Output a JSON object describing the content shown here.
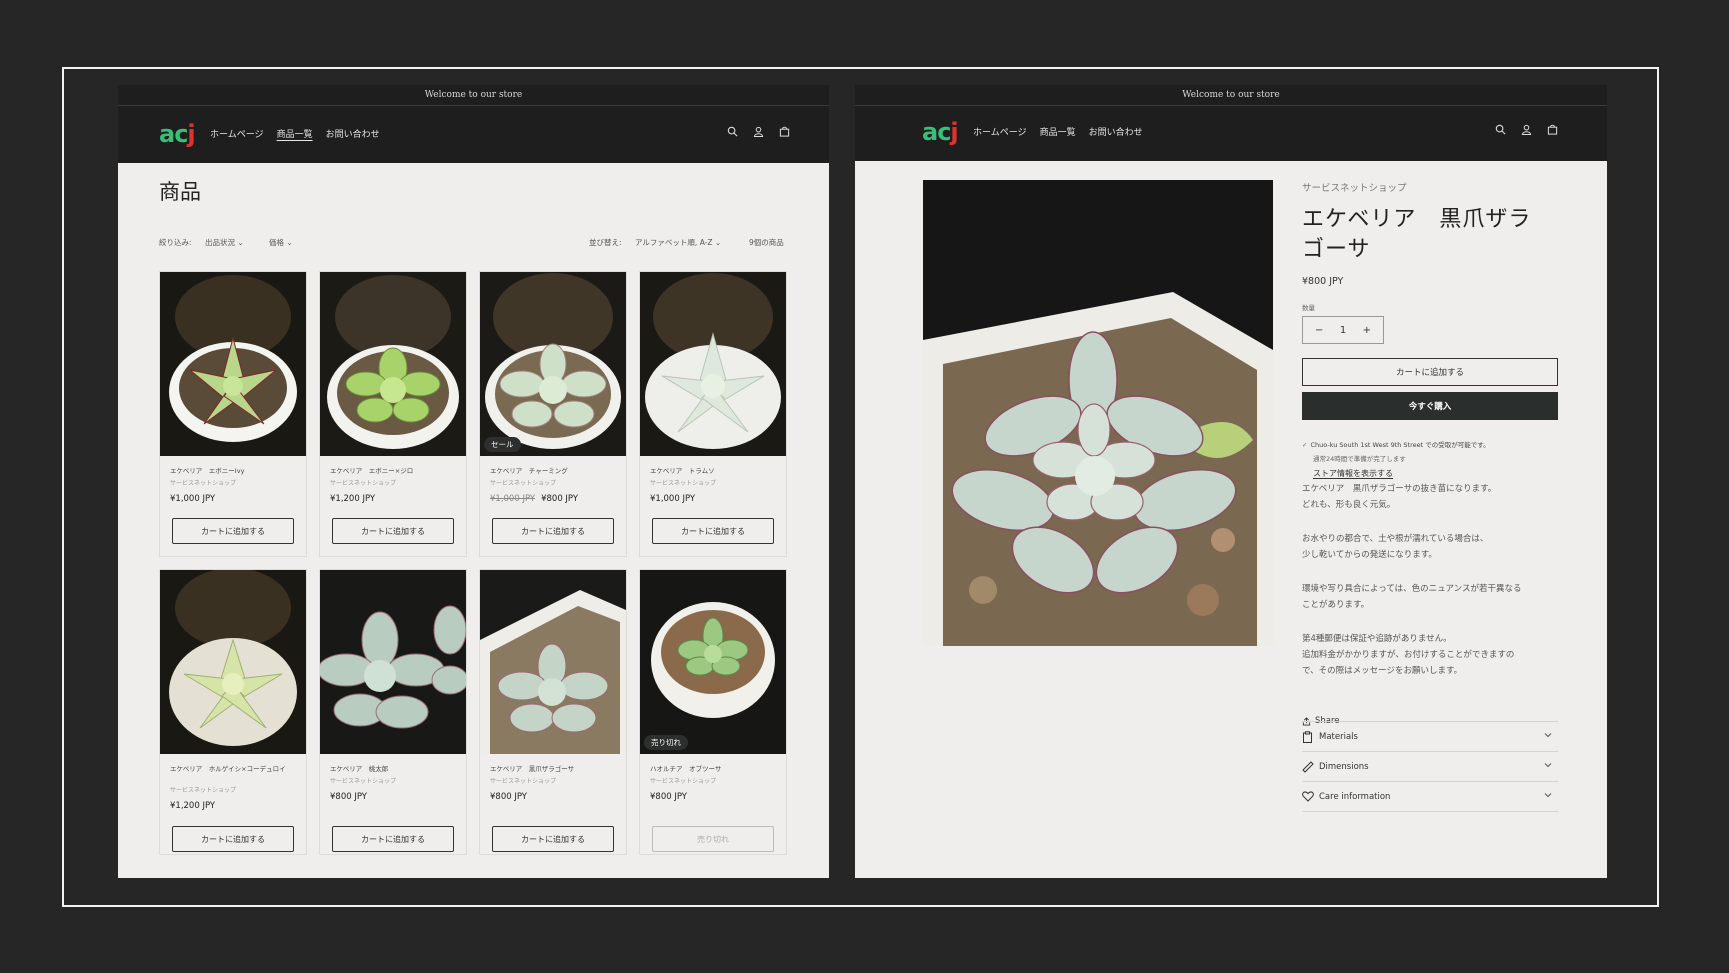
{
  "store": {
    "announcement": "Welcome to our store",
    "logo": "acj",
    "nav": [
      "ホームページ",
      "商品一覧",
      "お問い合わせ"
    ]
  },
  "collection": {
    "title": "商品",
    "filter_label": "絞り込み:",
    "filter_availability": "出品状況",
    "filter_price": "価格",
    "sort_label": "並び替え:",
    "sort_value": "アルファベット順, A-Z",
    "count": "9個の商品",
    "products": [
      {
        "name": "エケベリア　エボニーIvy",
        "vendor": "サービスネットショップ",
        "price": "¥1,000 JPY",
        "button": "カートに追加する"
      },
      {
        "name": "エケベリア　エボニー×ジロ",
        "vendor": "サービスネットショップ",
        "price": "¥1,200 JPY",
        "button": "カートに追加する"
      },
      {
        "name": "エケベリア　チャーミング",
        "vendor": "サービスネットショップ",
        "price_old": "¥1,000 JPY",
        "price": "¥800 JPY",
        "badge": "セール",
        "button": "カートに追加する"
      },
      {
        "name": "エケベリア　トラムソ",
        "vendor": "サービスネットショップ",
        "price": "¥1,000 JPY",
        "button": "カートに追加する"
      },
      {
        "name": "エケベリア　ホルゲイシ×コーデュロイ",
        "vendor": "サービスネットショップ",
        "price": "¥1,200 JPY",
        "button": "カートに追加する"
      },
      {
        "name": "エケベリア　桃太郎",
        "vendor": "サービスネットショップ",
        "price": "¥800 JPY",
        "button": "カートに追加する"
      },
      {
        "name": "エケベリア　黒爪ザラゴーサ",
        "vendor": "サービスネットショップ",
        "price": "¥800 JPY",
        "button": "カートに追加する"
      },
      {
        "name": "ハオルチア　オブツーサ",
        "vendor": "サービスネットショップ",
        "price": "¥800 JPY",
        "badge": "売り切れ",
        "button": "売り切れ"
      }
    ]
  },
  "product": {
    "vendor": "サービスネットショップ",
    "title": "エケベリア　黒爪ザラゴーサ",
    "price": "¥800 JPY",
    "quantity_label": "数量",
    "quantity": "1",
    "minus": "−",
    "plus": "+",
    "add_to_cart": "カートに追加する",
    "buy_now": "今すぐ購入",
    "pickup": "Chuo-ku South 1st West 9th Street での受取が可能です。",
    "pickup_time": "通常24時間で準備が完了します",
    "store_link": "ストア情報を表示する",
    "desc1": [
      "エケベリア　黒爪ザラゴーサの抜き苗になります。",
      "どれも、形も良く元気。"
    ],
    "desc2": [
      "お水やりの都合で、土や根が濡れている場合は、",
      "少し乾いてからの発送になります。"
    ],
    "desc3": [
      "環境や写り具合によっては、色のニュアンスが若干異なる",
      "ことがあります。"
    ],
    "desc4": [
      "第4種郵便は保証や追跡がありません。",
      "追加料金がかかりますが、お付けすることができますの",
      "で、その際はメッセージをお願いします。"
    ],
    "share": "Share",
    "accordions": [
      "Materials",
      "Dimensions",
      "Care information"
    ]
  }
}
